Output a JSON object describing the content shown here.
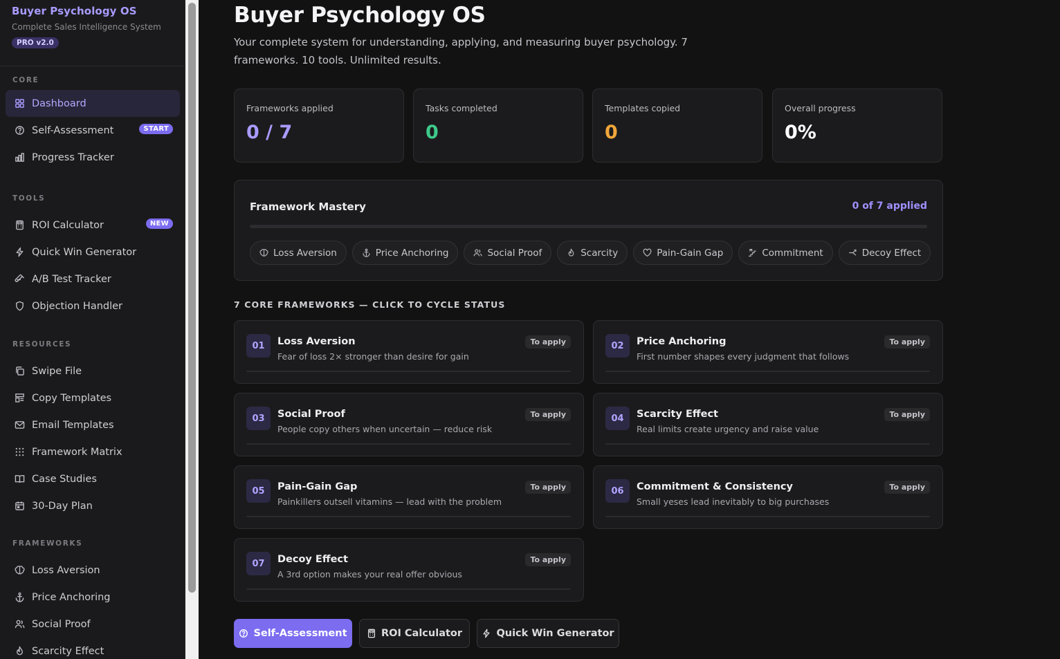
{
  "brand": {
    "title": "Buyer Psychology OS",
    "subtitle": "Complete Sales Intelligence System",
    "badge": "PRO v2.0"
  },
  "sidebar": {
    "sections": [
      {
        "label": "CORE",
        "items": [
          {
            "label": "Dashboard",
            "icon": "grid-icon",
            "active": true
          },
          {
            "label": "Self-Assessment",
            "icon": "circle-question-icon",
            "badge": "START"
          },
          {
            "label": "Progress Tracker",
            "icon": "bar-chart-icon"
          }
        ]
      },
      {
        "label": "TOOLS",
        "items": [
          {
            "label": "ROI Calculator",
            "icon": "calculator-icon",
            "badge": "NEW"
          },
          {
            "label": "Quick Win Generator",
            "icon": "lightning-icon"
          },
          {
            "label": "A/B Test Tracker",
            "icon": "flask-icon"
          },
          {
            "label": "Objection Handler",
            "icon": "shield-icon"
          }
        ]
      },
      {
        "label": "RESOURCES",
        "items": [
          {
            "label": "Swipe File",
            "icon": "copy-icon"
          },
          {
            "label": "Copy Templates",
            "icon": "layout-icon"
          },
          {
            "label": "Email Templates",
            "icon": "mail-icon"
          },
          {
            "label": "Framework Matrix",
            "icon": "dots-grid-icon"
          },
          {
            "label": "Case Studies",
            "icon": "book-icon"
          },
          {
            "label": "30-Day Plan",
            "icon": "calendar-icon"
          }
        ]
      },
      {
        "label": "FRAMEWORKS",
        "items": [
          {
            "label": "Loss Aversion",
            "icon": "brain-icon"
          },
          {
            "label": "Price Anchoring",
            "icon": "anchor-icon"
          },
          {
            "label": "Social Proof",
            "icon": "users-icon"
          },
          {
            "label": "Scarcity Effect",
            "icon": "flame-icon"
          }
        ]
      }
    ]
  },
  "header": {
    "title": "Buyer Psychology OS",
    "description": "Your complete system for understanding, applying, and measuring buyer psychology. 7 frameworks. 10 tools. Unlimited results."
  },
  "stats": [
    {
      "label": "Frameworks applied",
      "value": "0 / 7",
      "color": "#a99bff"
    },
    {
      "label": "Tasks completed",
      "value": "0",
      "color": "#3ec98a"
    },
    {
      "label": "Templates copied",
      "value": "0",
      "color": "#f0a63a"
    },
    {
      "label": "Overall progress",
      "value": "0%",
      "color": "#ffffff"
    }
  ],
  "mastery": {
    "title": "Framework Mastery",
    "count": "0 of 7 applied",
    "progress_fraction": 0,
    "chips": [
      {
        "label": "Loss Aversion",
        "icon": "brain-icon"
      },
      {
        "label": "Price Anchoring",
        "icon": "anchor-icon"
      },
      {
        "label": "Social Proof",
        "icon": "users-icon"
      },
      {
        "label": "Scarcity",
        "icon": "flame-icon"
      },
      {
        "label": "Pain-Gain Gap",
        "icon": "heart-icon"
      },
      {
        "label": "Commitment",
        "icon": "stairs-icon"
      },
      {
        "label": "Decoy Effect",
        "icon": "split-icon"
      }
    ]
  },
  "frameworks_label": "7 CORE FRAMEWORKS — CLICK TO CYCLE STATUS",
  "frameworks": [
    {
      "num": "01",
      "title": "Loss Aversion",
      "subtitle": "Fear of loss 2× stronger than desire for gain",
      "status": "To apply"
    },
    {
      "num": "02",
      "title": "Price Anchoring",
      "subtitle": "First number shapes every judgment that follows",
      "status": "To apply"
    },
    {
      "num": "03",
      "title": "Social Proof",
      "subtitle": "People copy others when uncertain — reduce risk",
      "status": "To apply"
    },
    {
      "num": "04",
      "title": "Scarcity Effect",
      "subtitle": "Real limits create urgency and raise value",
      "status": "To apply"
    },
    {
      "num": "05",
      "title": "Pain-Gain Gap",
      "subtitle": "Painkillers outsell vitamins — lead with the problem",
      "status": "To apply"
    },
    {
      "num": "06",
      "title": "Commitment & Consistency",
      "subtitle": "Small yeses lead inevitably to big purchases",
      "status": "To apply"
    },
    {
      "num": "07",
      "title": "Decoy Effect",
      "subtitle": "A 3rd option makes your real offer obvious",
      "status": "To apply"
    }
  ],
  "actions": [
    {
      "label": "Self-Assessment",
      "icon": "circle-question-icon",
      "primary": true
    },
    {
      "label": "ROI Calculator",
      "icon": "calculator-icon"
    },
    {
      "label": "Quick Win Generator",
      "icon": "lightning-icon"
    }
  ]
}
